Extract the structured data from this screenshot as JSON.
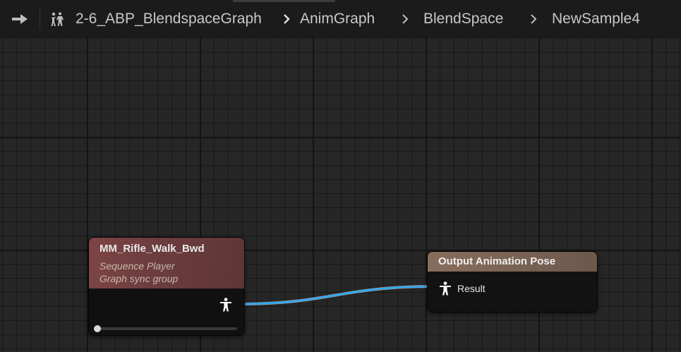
{
  "breadcrumb": {
    "items": [
      {
        "label": "2-6_ABP_BlendspaceGraph"
      },
      {
        "label": "AnimGraph"
      },
      {
        "label": "BlendSpace"
      },
      {
        "label": "NewSample4"
      }
    ]
  },
  "nodes": {
    "sequence_player": {
      "title": "MM_Rifle_Walk_Bwd",
      "subtitle": "Sequence Player",
      "subtitle2": "Graph sync group",
      "play_position": 0
    },
    "output_pose": {
      "title": "Output Animation Pose",
      "pin_label": "Result"
    }
  },
  "colors": {
    "wire": "#2aa9f5",
    "sequence_header": "#7e4546",
    "output_header": "#876d5c"
  },
  "icons": {
    "nav": "arrow-right-icon",
    "anim_blueprint": "anim-blueprint-icon",
    "pose": "pose-pin-icon"
  }
}
